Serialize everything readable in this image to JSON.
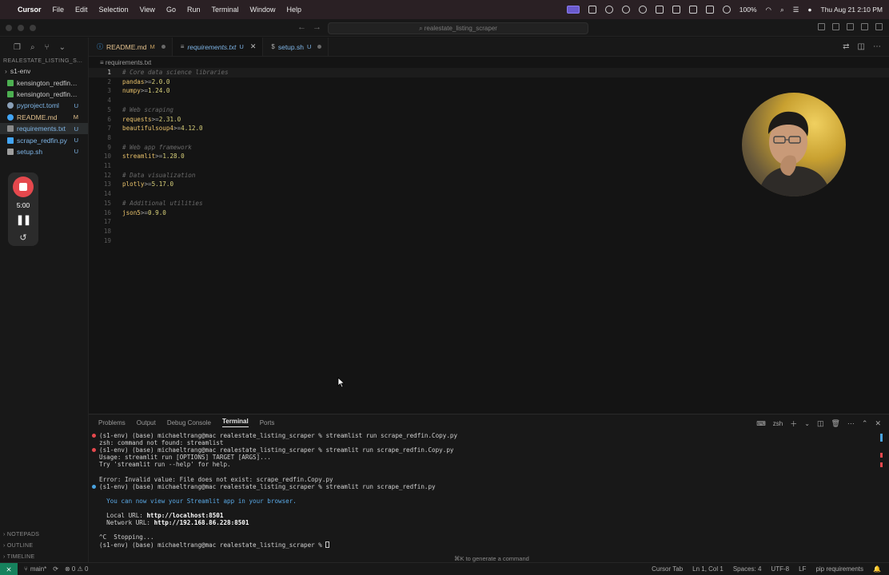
{
  "menubar": {
    "app_name": "Cursor",
    "menus": [
      "File",
      "Edit",
      "Selection",
      "View",
      "Go",
      "Run",
      "Terminal",
      "Window",
      "Help"
    ],
    "battery": "100%",
    "datetime": "Thu Aug 21  2:10 PM"
  },
  "titlebar": {
    "search_placeholder": "realestate_listing_scraper"
  },
  "explorer": {
    "section_title": "REALESTATE_LISTING_S...",
    "folder": "s1-env",
    "files": [
      {
        "name": "kensington_redfin_li...",
        "status": "",
        "color": "#4caf50"
      },
      {
        "name": "kensington_redfin_li...",
        "status": "",
        "color": "#4caf50"
      },
      {
        "name": "pyproject.toml",
        "status": "U",
        "color": "#9e9e9e"
      },
      {
        "name": "README.md",
        "status": "M",
        "color": "#42a5f5"
      },
      {
        "name": "requirements.txt",
        "status": "U",
        "color": "#e8c16a"
      },
      {
        "name": "scrape_redfin.py",
        "status": "U",
        "color": "#42a5f5"
      },
      {
        "name": "setup.sh",
        "status": "U",
        "color": "#9e9e9e"
      }
    ],
    "bottom_sections": [
      "NOTEPADS",
      "OUTLINE",
      "TIMELINE"
    ]
  },
  "recorder": {
    "time": "5:00"
  },
  "tabs": [
    {
      "label": "README.md",
      "badge": "M",
      "icon": "markdown-icon"
    },
    {
      "label": "requirements.txt",
      "badge": "U",
      "icon": "text-file-icon",
      "active": true
    },
    {
      "label": "setup.sh",
      "badge": "U",
      "icon": "shell-icon"
    }
  ],
  "breadcrumb": "requirements.txt",
  "editor": {
    "lines": [
      {
        "n": "1",
        "type": "comment",
        "text": "# Core data science libraries"
      },
      {
        "n": "2",
        "type": "pkg",
        "pkg": "pandas",
        "op": ">=",
        "ver": "2.0.0"
      },
      {
        "n": "3",
        "type": "pkg",
        "pkg": "numpy",
        "op": ">=",
        "ver": "1.24.0"
      },
      {
        "n": "4",
        "type": "blank",
        "text": ""
      },
      {
        "n": "5",
        "type": "comment",
        "text": "# Web scraping"
      },
      {
        "n": "6",
        "type": "pkg",
        "pkg": "requests",
        "op": ">=",
        "ver": "2.31.0"
      },
      {
        "n": "7",
        "type": "pkg",
        "pkg": "beautifulsoup4",
        "op": ">=",
        "ver": "4.12.0"
      },
      {
        "n": "8",
        "type": "blank",
        "text": ""
      },
      {
        "n": "9",
        "type": "comment",
        "text": "# Web app framework"
      },
      {
        "n": "10",
        "type": "pkg",
        "pkg": "streamlit",
        "op": ">=",
        "ver": "1.28.0"
      },
      {
        "n": "11",
        "type": "blank",
        "text": ""
      },
      {
        "n": "12",
        "type": "comment",
        "text": "# Data visualization"
      },
      {
        "n": "13",
        "type": "pkg",
        "pkg": "plotly",
        "op": ">=",
        "ver": "5.17.0"
      },
      {
        "n": "14",
        "type": "blank",
        "text": ""
      },
      {
        "n": "15",
        "type": "comment",
        "text": "# Additional utilities"
      },
      {
        "n": "16",
        "type": "pkg",
        "pkg": "json5",
        "op": ">=",
        "ver": "0.9.0"
      },
      {
        "n": "17",
        "type": "blank",
        "text": ""
      },
      {
        "n": "18",
        "type": "blank",
        "text": ""
      },
      {
        "n": "19",
        "type": "blank",
        "text": ""
      }
    ]
  },
  "panel": {
    "tabs": [
      "Problems",
      "Output",
      "Debug Console",
      "Terminal",
      "Ports"
    ],
    "active_tab": "Terminal",
    "shell": "zsh",
    "terminal_lines": [
      {
        "text": "(s1-env) (base) michaeltrang@mac realestate_listing_scraper % streamlist run scrape_redfin.Copy.py",
        "dot": "#e5484d"
      },
      {
        "text": "zsh: command not found: streamlist"
      },
      {
        "text": "(s1-env) (base) michaeltrang@mac realestate_listing_scraper % streamlit run scrape_redfin.Copy.py",
        "dot": "#e5484d"
      },
      {
        "text": "Usage: streamlit run [OPTIONS] TARGET [ARGS]..."
      },
      {
        "text": "Try 'streamlit run --help' for help."
      },
      {
        "text": ""
      },
      {
        "text": "Error: Invalid value: File does not exist: scrape_redfin.Copy.py"
      },
      {
        "text": "(s1-env) (base) michaeltrang@mac realestate_listing_scraper % streamlit run scrape_redfin.py",
        "dot": "#4aa3df"
      },
      {
        "text": ""
      },
      {
        "text": "  You can now view your Streamlit app in your browser.",
        "info": true
      },
      {
        "text": ""
      },
      {
        "text": "  Local URL: ",
        "bold": "http://localhost:8501"
      },
      {
        "text": "  Network URL: ",
        "bold": "http://192.168.86.228:8501"
      },
      {
        "text": ""
      },
      {
        "text": "^C  Stopping..."
      },
      {
        "text": "(s1-env) (base) michaeltrang@mac realestate_listing_scraper % ",
        "cursor": true
      }
    ],
    "hint": "⌘K to generate a command"
  },
  "statusbar": {
    "branch": "main*",
    "problems": "⊗ 0 ⚠ 0",
    "items": [
      "Cursor Tab",
      "Ln 1, Col 1",
      "Spaces: 4",
      "UTF-8",
      "LF",
      "pip requirements"
    ]
  }
}
